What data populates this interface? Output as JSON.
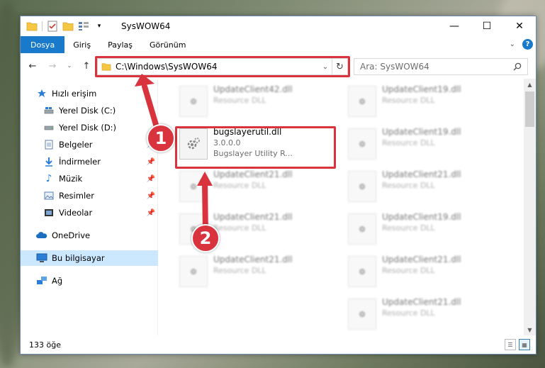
{
  "window": {
    "title": "SysWOW64",
    "controls": {
      "minimize": "—",
      "maximize": "☐",
      "close": "✕"
    }
  },
  "ribbon": {
    "tabs": [
      {
        "label": "Dosya"
      },
      {
        "label": "Giriş"
      },
      {
        "label": "Paylaş"
      },
      {
        "label": "Görünüm"
      }
    ]
  },
  "navigation": {
    "address": "C:\\Windows\\SysWOW64",
    "search_placeholder": "Ara: SysWOW64"
  },
  "sidebar": {
    "items": [
      {
        "label": "Hızlı erişim",
        "icon": "star-icon",
        "pinned": false
      },
      {
        "label": "Yerel Disk (C:)",
        "icon": "disk-icon",
        "pinned": false
      },
      {
        "label": "Yerel Disk (D:)",
        "icon": "disk-icon",
        "pinned": false
      },
      {
        "label": "Belgeler",
        "icon": "documents-icon",
        "pinned": true
      },
      {
        "label": "İndirmeler",
        "icon": "download-icon",
        "pinned": true
      },
      {
        "label": "Müzik",
        "icon": "music-icon",
        "pinned": true
      },
      {
        "label": "Resimler",
        "icon": "pictures-icon",
        "pinned": true
      },
      {
        "label": "Videolar",
        "icon": "video-icon",
        "pinned": true
      },
      {
        "label": "OneDrive",
        "icon": "cloud-icon",
        "pinned": false
      },
      {
        "label": "Bu bilgisayar",
        "icon": "computer-icon",
        "pinned": false,
        "selected": true
      },
      {
        "label": "Ağ",
        "icon": "network-icon",
        "pinned": false
      }
    ]
  },
  "files": {
    "highlighted": {
      "name": "bugslayerutil.dll",
      "version": "3.0.0.0",
      "description": "Bugslayer Utility R..."
    },
    "background": [
      {
        "name": "UpdateClient42.dll",
        "sub": "Resource DLL"
      },
      {
        "name": "UpdateClient19.dll",
        "sub": "Resource DLL"
      },
      {
        "name": "UpdateClient19.dll",
        "sub": "Resource DLL"
      },
      {
        "name": "UpdateClient21.dll",
        "sub": "Resource DLL"
      },
      {
        "name": "UpdateClient21.dll",
        "sub": "Resource DLL"
      },
      {
        "name": "UpdateClient21.dll",
        "sub": "Resource DLL"
      },
      {
        "name": "UpdateClient19.dll",
        "sub": "Resource DLL"
      },
      {
        "name": "UpdateClient21.dll",
        "sub": "Resource DLL"
      },
      {
        "name": "UpdateClient21.dll",
        "sub": "Resource DLL"
      },
      {
        "name": "UpdateClient21.dll",
        "sub": "Resource DLL"
      }
    ]
  },
  "status": {
    "item_count": "133 öğe"
  },
  "annotations": {
    "step1": "1",
    "step2": "2",
    "color": "#d9343e"
  }
}
